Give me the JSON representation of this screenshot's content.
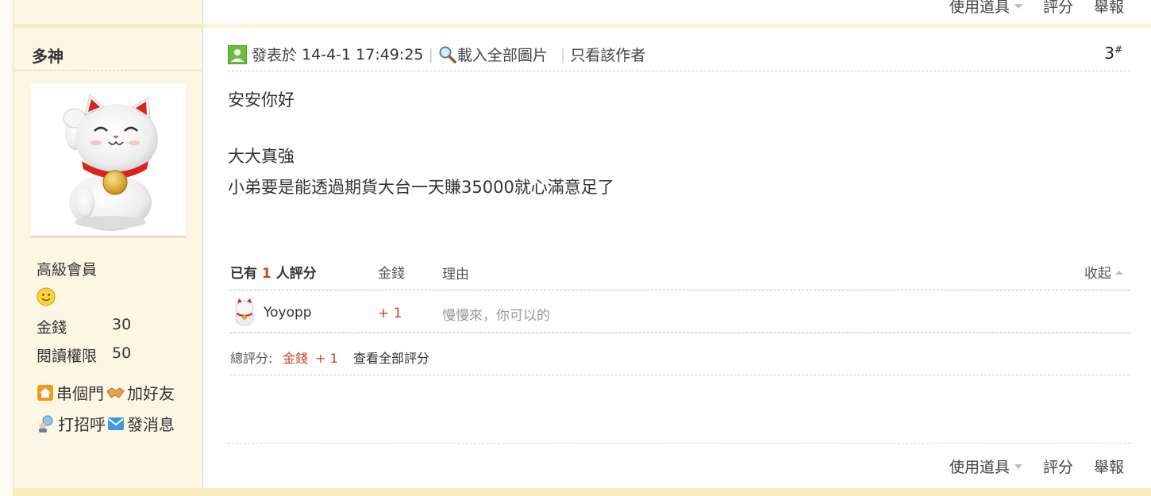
{
  "top_actions": {
    "use_tool": "使用道具",
    "rate": "評分",
    "report": "舉報"
  },
  "author": {
    "name": "多神",
    "rank": "高級會員",
    "stats": [
      {
        "label": "金錢",
        "value": "30"
      },
      {
        "label": "閱讀權限",
        "value": "50"
      }
    ],
    "links": {
      "visit": "串個門",
      "add_friend": "加好友",
      "greet": "打招呼",
      "message": "發消息"
    }
  },
  "post": {
    "posted_prefix": "發表於",
    "posted_time": "14-4-1 17:49:25",
    "load_images": "載入全部圖片",
    "only_author": "只看該作者",
    "floor": "3",
    "floor_mark": "#",
    "lines": [
      "安安你好",
      "大大真強",
      "小弟要是能透過期貨大台一天賺35000就心滿意足了"
    ]
  },
  "rating": {
    "head_prefix": "已有",
    "head_count": "1",
    "head_suffix": "人評分",
    "col_money": "金錢",
    "col_reason": "理由",
    "collapse": "收起",
    "rows": [
      {
        "user": "Yoyopp",
        "money": "+ 1",
        "reason": "慢慢來，你可以的"
      }
    ],
    "total_label": "總評分:",
    "total_money_label": "金錢",
    "total_money_value": "+ 1",
    "view_all": "查看全部評分"
  },
  "bottom_actions": {
    "use_tool": "使用道具",
    "rate": "評分",
    "report": "舉報"
  },
  "colors": {
    "sidebar_bg": "#fcf7e5",
    "band": "#fbecc0",
    "accent_red": "#c8462a"
  }
}
